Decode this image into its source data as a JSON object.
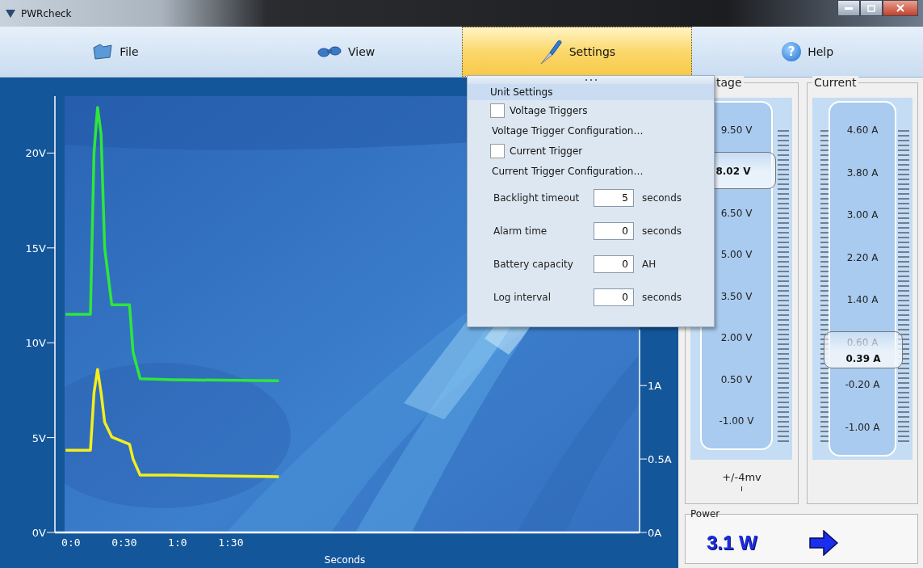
{
  "window": {
    "title": "PWRcheck"
  },
  "menu": [
    {
      "label": "File",
      "selected": false
    },
    {
      "label": "View",
      "selected": false
    },
    {
      "label": "Settings",
      "selected": true
    },
    {
      "label": "Help",
      "selected": false,
      "icon_text": "?"
    }
  ],
  "chart": {
    "chart_data": {
      "type": "line",
      "xlabel": "Seconds",
      "x": [
        -3,
        11,
        13,
        15,
        17,
        19,
        23,
        33,
        35,
        39,
        57,
        117
      ],
      "series": [
        {
          "color": "#2ee63c",
          "values": [
            11.5,
            11.5,
            20,
            22.4,
            21,
            15,
            12,
            12,
            9.5,
            8.1,
            8.05,
            8.0
          ]
        },
        {
          "color": "#f4ee1c",
          "axis": "y2",
          "values": [
            0.56,
            0.56,
            0.95,
            1.11,
            0.95,
            0.75,
            0.65,
            0.6,
            0.5,
            0.39,
            0.39,
            0.38
          ]
        }
      ],
      "xlim": [
        -9,
        320
      ],
      "ylim": [
        0,
        23
      ],
      "y2lim": [
        0,
        2.97
      ],
      "xticks": [
        {
          "value": 0,
          "label": "0:0"
        },
        {
          "value": 30,
          "label": "0:30"
        },
        {
          "value": 60,
          "label": "1:0"
        },
        {
          "value": 90,
          "label": "1:30"
        }
      ],
      "yticks": [
        {
          "value": 0,
          "label": "0V"
        },
        {
          "value": 5,
          "label": "5V"
        },
        {
          "value": 10,
          "label": "10V"
        },
        {
          "value": 15,
          "label": "15V"
        },
        {
          "value": 20,
          "label": "20V"
        }
      ],
      "y2ticks": [
        {
          "value": 0,
          "label": "0A"
        },
        {
          "value": 0.5,
          "label": "0.5A"
        },
        {
          "value": 1,
          "label": "1A"
        }
      ]
    }
  },
  "settings_menu": {
    "title": "Unit Settings",
    "items": [
      {
        "kind": "checkbox",
        "label": "Voltage Triggers",
        "checked": false
      },
      {
        "kind": "command",
        "label": "Voltage Trigger Configuration…"
      },
      {
        "kind": "checkbox",
        "label": "Current Trigger",
        "checked": false
      },
      {
        "kind": "command",
        "label": "Current Trigger Configuration…"
      },
      {
        "kind": "field",
        "label": "Backlight timeout",
        "value": "5",
        "unit": "seconds"
      },
      {
        "kind": "field",
        "label": "Alarm time",
        "value": "0",
        "unit": "seconds"
      },
      {
        "kind": "field",
        "label": "Battery capacity",
        "value": "0",
        "unit": "AH"
      },
      {
        "kind": "field",
        "label": "Log interval",
        "value": "0",
        "unit": "seconds"
      }
    ]
  },
  "voltage": {
    "title": "tage",
    "scale": [
      "9.50 V",
      "6.50 V",
      "5.00 V",
      "3.50 V",
      "2.00 V",
      "0.50 V",
      "-1.00 V"
    ],
    "reading": "8.02 V",
    "level": 0.8,
    "resolution": "+/-4mv"
  },
  "current": {
    "title": "Current",
    "scale": [
      "4.60 A",
      "3.80 A",
      "3.00 A",
      "2.20 A",
      "1.40 A",
      "0.60 A",
      "-0.20 A",
      "-1.00 A"
    ],
    "reading": "0.39 A",
    "level": 0.3
  },
  "power": {
    "title": "Power",
    "value": "3.1 W"
  }
}
